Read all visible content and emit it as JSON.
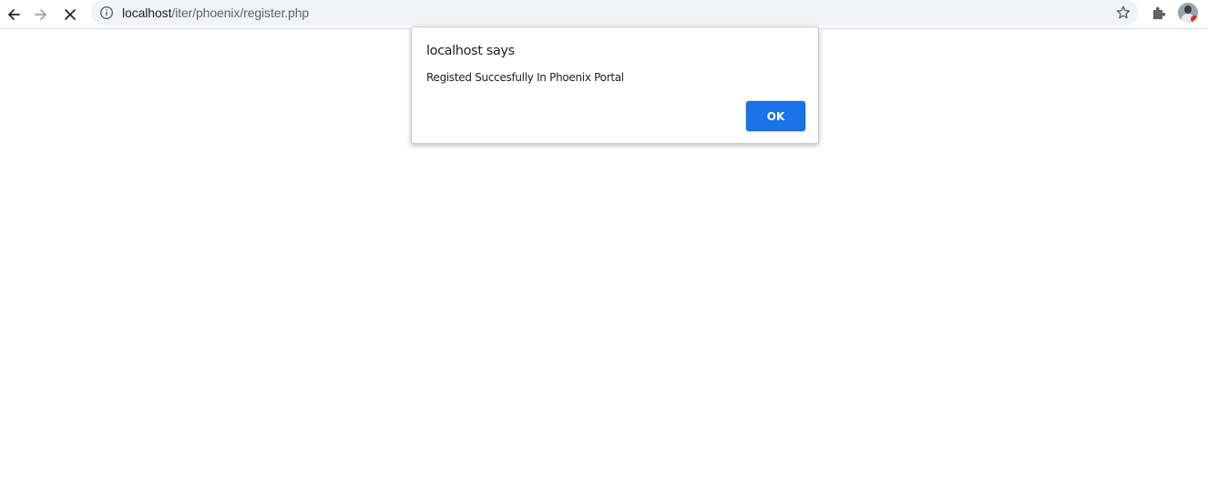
{
  "browser": {
    "url_host": "localhost",
    "url_path": "/iter/phoenix/register.php",
    "icons": {
      "back": "back-arrow-icon",
      "forward": "forward-arrow-icon",
      "stop": "stop-loading-icon",
      "info": "info-icon",
      "star": "star-icon",
      "extensions": "puzzle-piece-icon",
      "profile": "profile-avatar"
    }
  },
  "dialog": {
    "title": "localhost says",
    "message": "Registed Succesfully In Phoenix Portal",
    "ok_label": "OK"
  },
  "colors": {
    "accent": "#1a73e8",
    "omnibox_bg": "#f1f3f4"
  }
}
